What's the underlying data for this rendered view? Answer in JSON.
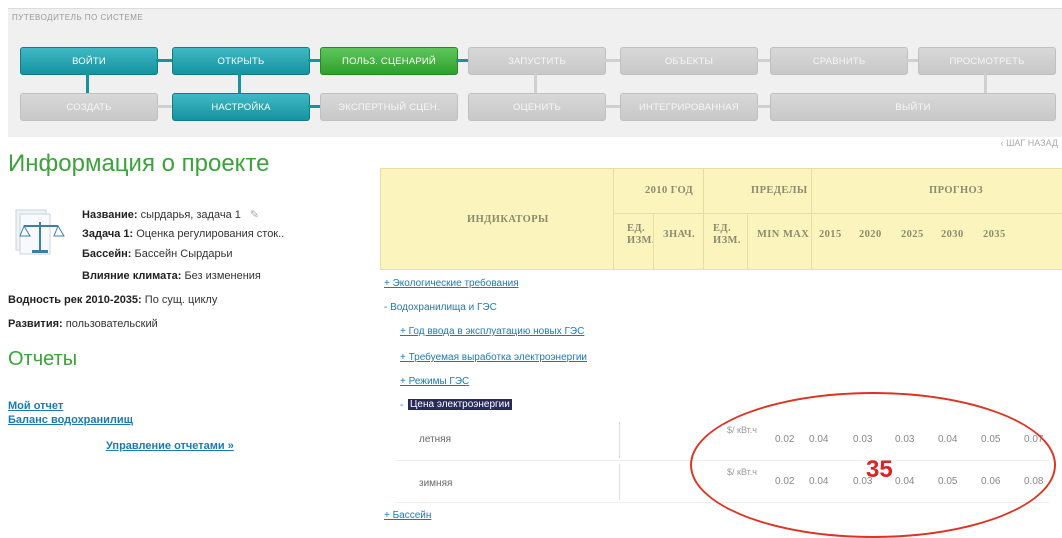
{
  "wizard": {
    "title": "ПУТЕВОДИТЕЛЬ ПО СИСТЕМЕ",
    "steps": {
      "login": "ВОЙТИ",
      "open": "ОТКРЫТЬ",
      "user_scenario": "ПОЛЬЗ. СЦЕНАРИЙ",
      "run": "ЗАПУСТИТЬ",
      "objects": "ОБЪЕКТЫ",
      "compare": "СРАВНИТЬ",
      "view": "ПРОСМОТРЕТЬ",
      "create": "СОЗДАТЬ",
      "settings": "НАСТРОЙКА",
      "expert": "ЭКСПЕРТНЫЙ СЦЕН.",
      "evaluate": "ОЦЕНИТЬ",
      "integrated": "ИНТЕГРИРОВАННАЯ",
      "exit": "ВЫЙТИ"
    },
    "step_back": "‹ ШАГ НАЗАД"
  },
  "project": {
    "heading": "Информация о проекте",
    "name_label": "Название:",
    "name_value": "сырдарья, задача 1",
    "task_label": "Задача 1:",
    "task_value": "Оценка регулирования сток..",
    "basin_label": "Бассейн:",
    "basin_value": "Бассейн Сырдарьи",
    "climate_label": "Влияние климата:",
    "climate_value": "Без изменения",
    "water_label": "Водность рек 2010-2035:",
    "water_value": "По сущ. циклу",
    "dev_label": "Развития:",
    "dev_value": "пользовательский"
  },
  "reports": {
    "heading": "Отчеты",
    "links": [
      "Мой отчет",
      "Баланс водохранилищ"
    ],
    "manage": "Управление отчетами »"
  },
  "table": {
    "indicators": "ИНДИКАТОРЫ",
    "year2010": "2010 ГОД",
    "limits": "ПРЕДЕЛЫ",
    "forecast": "ПРОГНОЗ",
    "unit_hdr": "ЕД. ИЗМ.",
    "val_hdr": "ЗНАЧ.",
    "min_hdr": "MIN",
    "max_hdr": "MAX",
    "years": [
      "2015",
      "2020",
      "2025",
      "2030",
      "2035"
    ]
  },
  "tree": {
    "eco": "+ Экологические требования",
    "res": "- Водохранилища и ГЭС",
    "year_new": "+ Год ввода в эксплуатацию новых ГЭС",
    "req_energy": "+ Требуемая выработка электроэнергии",
    "modes": "+ Режимы ГЭС",
    "price_prefix": "-",
    "price": "Цена электроэнергии",
    "basin": "+ Бассейн"
  },
  "rows": [
    {
      "label": "летняя",
      "unit": "$/ кВт.ч",
      "min": "0.02",
      "max": "0.04",
      "f": [
        "0.03",
        "0.03",
        "0.04",
        "0.05",
        "0.07"
      ]
    },
    {
      "label": "зимняя",
      "unit": "$/ кВт.ч",
      "min": "0.02",
      "max": "0.04",
      "f": [
        "0.03",
        "0.04",
        "0.05",
        "0.06",
        "0.08"
      ]
    }
  ],
  "annotation": "35",
  "colors": {
    "teal": "#1593a0",
    "green": "#2ea02c",
    "heading_green": "#3aa33a",
    "header_yellow": "#fbf5bd",
    "annotation_red": "#d32"
  }
}
